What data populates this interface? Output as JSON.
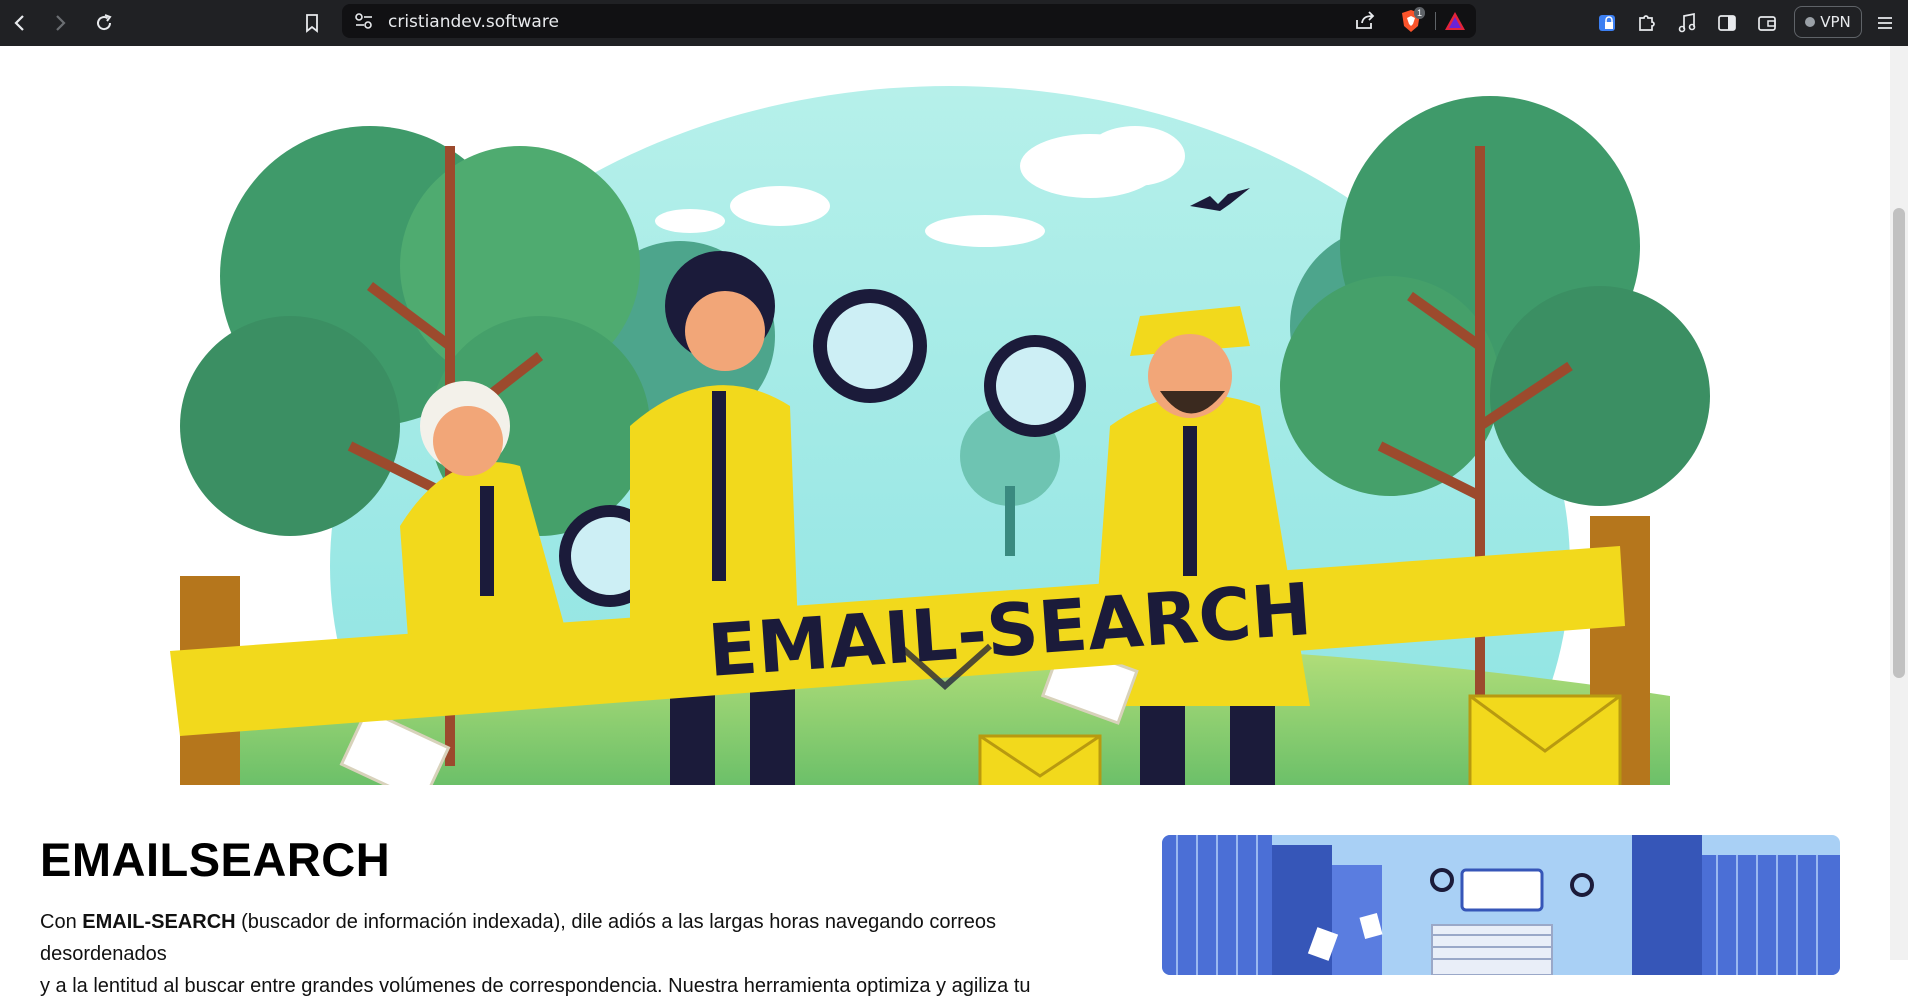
{
  "browser": {
    "url": "cristiandev.software",
    "shield_badge": "1",
    "vpn_label": "VPN"
  },
  "hero": {
    "banner_text": "EMAIL-SEARCH"
  },
  "section": {
    "title": "EMAILSEARCH",
    "para_prefix": "Con ",
    "para_bold": "EMAIL-SEARCH",
    "para_line1_rest": " (buscador de información indexada), dile adiós a las largas horas navegando correos desordenados",
    "para_line2": "y a la lentitud al buscar entre grandes volúmenes de correspondencia. Nuestra herramienta optimiza y agiliza tu"
  },
  "colors": {
    "chrome_bg": "#202124",
    "urlbar_bg": "#111113",
    "accent_yellow": "#f2d91c",
    "sky": "#8ee6e0"
  }
}
